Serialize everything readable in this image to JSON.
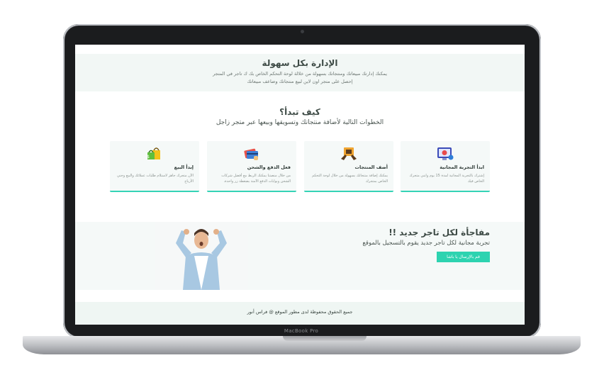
{
  "device": {
    "brand": "MacBook Pro"
  },
  "hero": {
    "title": "الإدارة بكل سهولة",
    "line1": "يمكنك إدارتك مبيعاتك ومنتجاتك بسهولة من خلالة لوحة التحكم الخاص بك ك تاجر في المتجر",
    "line2": "إحصل على متجر اون لاين لبيع منتجاتك وضاعف مبيعاتك"
  },
  "start": {
    "title": "كيف تبدأ؟",
    "subtitle": "الخطوات التالية لأضافة منتجاتك وتسويقها وبيعها عبر متجر زاجل"
  },
  "cards": [
    {
      "icon": "free-trial-icon",
      "title": "ابدأ التجربة المجانية",
      "text": "إشترك بالتجربة المجانية لمدة 15 يوم وابني متجرك الخاص فيك"
    },
    {
      "icon": "add-products-icon",
      "title": "أضف المنتجات",
      "text": "يمكنك إضافة منتجاتك بسهولة من خلال لوحة التحكم الخاص بمتجرك"
    },
    {
      "icon": "payment-card-icon",
      "title": "فعل الدفع والشحن",
      "text": "من خلال منصتنا يمكنك الربط مع أفضل شركات الشحن وبوابات الدفع الآمنة بضغطة زر واحدة."
    },
    {
      "icon": "shopping-bag-icon",
      "title": "إبدأ البيع",
      "text": "الآن متجرك جاهز لاستلام طلبات عملائك والبيع وجني الأرباح"
    }
  ],
  "promo": {
    "title": "مفاجأة لكل تاجر جديد !!",
    "subtitle": "تجربة مجانية لكل تاجر جديد يقوم بالتسجيل بالموقع",
    "button": "قم بالإرسال يا باشا"
  },
  "footer": {
    "text": "جميع الحقوق محفوظة لدى مطور الموقع @ فراس أنور"
  },
  "colors": {
    "accent": "#2dd3b0",
    "card_bg": "#f5f9f8",
    "section_bg": "#f2f7f5"
  }
}
